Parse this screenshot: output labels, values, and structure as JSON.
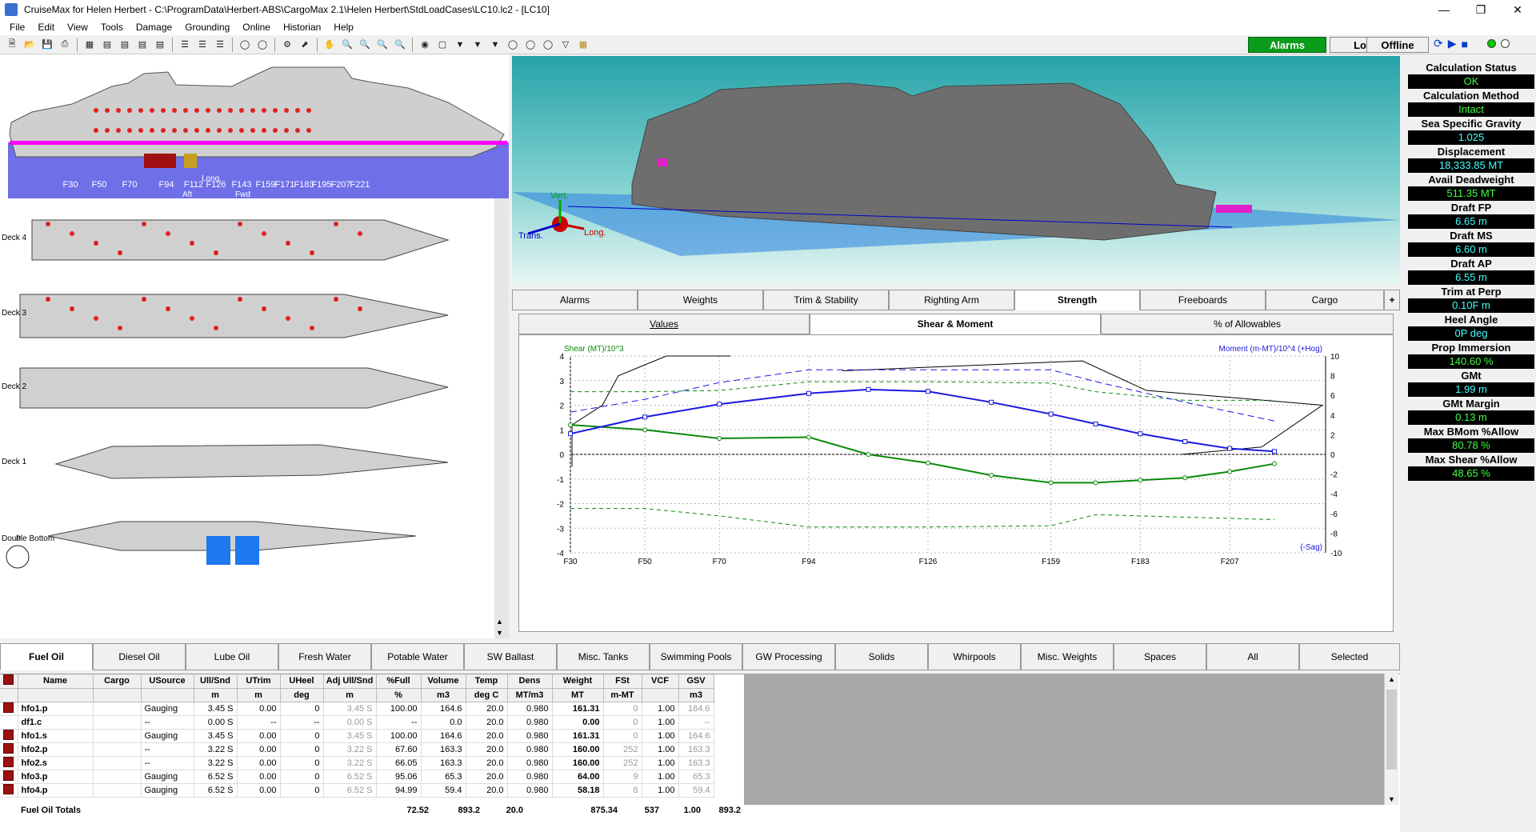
{
  "window": {
    "title": "CruiseMax for Helen Herbert - C:\\ProgramData\\Herbert-ABS\\CargoMax 2.1\\Helen Herbert\\StdLoadCases\\LC10.lc2 - [LC10]"
  },
  "menu": [
    "File",
    "Edit",
    "View",
    "Tools",
    "Damage",
    "Grounding",
    "Online",
    "Historian",
    "Help"
  ],
  "toolbar": {
    "alarms": "Alarms",
    "log": "Log",
    "offline": "Offline"
  },
  "profile": {
    "frames": [
      "F30",
      "F50",
      "F70",
      "F94",
      "F112",
      "F126",
      "F143",
      "F159",
      "F171",
      "F183",
      "F195",
      "F207",
      "F221"
    ],
    "aft": "Aft",
    "long": "Long.",
    "fwd": "Fwd"
  },
  "decks": [
    "Deck 4",
    "Deck 3",
    "Deck 2",
    "Deck 1",
    "Double Bottom"
  ],
  "compass": {
    "p": "P"
  },
  "view3d": {
    "vert": "Vert.",
    "trans": "Trans.",
    "long": "Long."
  },
  "main_tabs": [
    "Alarms",
    "Weights",
    "Trim & Stability",
    "Righting Arm",
    "Strength",
    "Freeboards",
    "Cargo"
  ],
  "main_tab_active": "Strength",
  "plus": "+",
  "sub_tabs": [
    "Values",
    "Shear & Moment",
    "% of Allowables"
  ],
  "chart_data": {
    "type": "line",
    "left_title": "Shear (MT)/10^3",
    "right_title": "Moment (m-MT)/10^4 (+Hog)",
    "sag_label": "(-Sag)",
    "x_ticks": [
      "F30",
      "F50",
      "F70",
      "F94",
      "F126",
      "F159",
      "F183",
      "F207"
    ],
    "ylim_left": [
      -4,
      4
    ],
    "ylim_right": [
      -10,
      10
    ],
    "y_ticks_left": [
      4,
      3,
      2,
      1,
      0,
      -1,
      -2,
      -3,
      -4
    ],
    "y_ticks_right": [
      10,
      8,
      6,
      4,
      2,
      0,
      -2,
      -4,
      -6,
      -8,
      -10
    ],
    "x": [
      30,
      50,
      70,
      94,
      110,
      126,
      143,
      159,
      171,
      183,
      195,
      207,
      219
    ],
    "shear": [
      1.2,
      1.0,
      0.65,
      0.7,
      0.0,
      -0.35,
      -0.85,
      -1.15,
      -1.15,
      -1.05,
      -0.95,
      -0.7,
      -0.38
    ],
    "moment": [
      2.1,
      3.8,
      5.1,
      6.2,
      6.6,
      6.4,
      5.3,
      4.1,
      3.1,
      2.1,
      1.3,
      0.6,
      0.3
    ],
    "shear_allow_pos": [
      [
        30,
        2.55
      ],
      [
        50,
        2.55
      ],
      [
        70,
        2.6
      ],
      [
        94,
        2.95
      ],
      [
        126,
        2.95
      ],
      [
        159,
        2.9
      ],
      [
        171,
        2.55
      ],
      [
        195,
        2.2
      ],
      [
        219,
        2.2
      ]
    ],
    "shear_allow_neg": [
      [
        30,
        -2.2
      ],
      [
        50,
        -2.2
      ],
      [
        70,
        -2.5
      ],
      [
        94,
        -2.95
      ],
      [
        126,
        -2.95
      ],
      [
        159,
        -2.9
      ],
      [
        171,
        -2.45
      ],
      [
        195,
        -2.55
      ],
      [
        219,
        -2.65
      ]
    ],
    "moment_allow": [
      [
        30,
        4.3
      ],
      [
        50,
        5.6
      ],
      [
        70,
        7.3
      ],
      [
        94,
        8.6
      ],
      [
        126,
        8.6
      ],
      [
        159,
        8.6
      ],
      [
        171,
        7.4
      ],
      [
        195,
        5.3
      ],
      [
        219,
        3.4
      ]
    ],
    "grid": true,
    "colors": {
      "shear": "#0a8a0a",
      "moment": "#1a1ae0"
    }
  },
  "status": [
    {
      "label": "Calculation Status",
      "value": "OK"
    },
    {
      "label": "Calculation Method",
      "value": "Intact"
    },
    {
      "label": "Sea Specific Gravity",
      "value": "1.025"
    },
    {
      "label": "Displacement",
      "value": "18,333.85 MT"
    },
    {
      "label": "Avail Deadweight",
      "value": "511.35 MT"
    },
    {
      "label": "Draft FP",
      "value": "6.65 m"
    },
    {
      "label": "Draft MS",
      "value": "6.60 m"
    },
    {
      "label": "Draft AP",
      "value": "6.55 m"
    },
    {
      "label": "Trim at Perp",
      "value": "0.10F m"
    },
    {
      "label": "Heel Angle",
      "value": "0P deg"
    },
    {
      "label": "Prop Immersion",
      "value": "140.60 %"
    },
    {
      "label": "GMt",
      "value": "1.99 m"
    },
    {
      "label": "GMt Margin",
      "value": "0.13 m"
    },
    {
      "label": "Max BMom %Allow",
      "value": "80.78 %"
    },
    {
      "label": "Max Shear %Allow",
      "value": "48.65 %"
    }
  ],
  "bottom_tabs": [
    "Fuel Oil",
    "Diesel Oil",
    "Lube Oil",
    "Fresh Water",
    "Potable Water",
    "SW Ballast",
    "Misc. Tanks",
    "Swimming Pools",
    "GW Processing",
    "Solids",
    "Whirpools",
    "Misc. Weights",
    "Spaces",
    "All",
    "Selected"
  ],
  "bottom_tab_active": "Fuel Oil",
  "table": {
    "headers": [
      "Name",
      "Cargo",
      "USource",
      "Ull/Snd",
      "UTrim",
      "UHeel",
      "Adj Ull/Snd",
      "%Full",
      "Volume",
      "Temp",
      "Dens",
      "Weight",
      "FSt",
      "VCF",
      "GSV"
    ],
    "units": [
      "",
      "",
      "",
      "m",
      "m",
      "deg",
      "m",
      "%",
      "m3",
      "deg C",
      "MT/m3",
      "MT",
      "m-MT",
      "",
      "m3"
    ],
    "rows": [
      [
        "hfo1.p",
        "",
        "Gauging",
        "3.45 S",
        "0.00",
        "0",
        "3.45 S",
        "100.00",
        "164.6",
        "20.0",
        "0.980",
        "161.31",
        "0",
        "1.00",
        "164.6"
      ],
      [
        "df1.c",
        "",
        "--",
        "0.00 S",
        "--",
        "--",
        "0.00 S",
        "--",
        "0.0",
        "20.0",
        "0.980",
        "0.00",
        "0",
        "1.00",
        "--"
      ],
      [
        "hfo1.s",
        "",
        "Gauging",
        "3.45 S",
        "0.00",
        "0",
        "3.45 S",
        "100.00",
        "164.6",
        "20.0",
        "0.980",
        "161.31",
        "0",
        "1.00",
        "164.6"
      ],
      [
        "hfo2.p",
        "",
        "--",
        "3.22 S",
        "0.00",
        "0",
        "3.22 S",
        "67.60",
        "163.3",
        "20.0",
        "0.980",
        "160.00",
        "252",
        "1.00",
        "163.3"
      ],
      [
        "hfo2.s",
        "",
        "--",
        "3.22 S",
        "0.00",
        "0",
        "3.22 S",
        "66.05",
        "163.3",
        "20.0",
        "0.980",
        "160.00",
        "252",
        "1.00",
        "163.3"
      ],
      [
        "hfo3.p",
        "",
        "Gauging",
        "6.52 S",
        "0.00",
        "0",
        "6.52 S",
        "95.06",
        "65.3",
        "20.0",
        "0.980",
        "64.00",
        "9",
        "1.00",
        "65.3"
      ],
      [
        "hfo4.p",
        "",
        "Gauging",
        "6.52 S",
        "0.00",
        "0",
        "6.52 S",
        "94.99",
        "59.4",
        "20.0",
        "0.980",
        "58.18",
        "8",
        "1.00",
        "59.4"
      ]
    ],
    "totals_label": "Fuel Oil Totals",
    "totals": {
      "pct": "72.52",
      "volume": "893.2",
      "temp": "20.0",
      "weight": "875.34",
      "fst": "537",
      "vcf": "1.00",
      "gsv": "893.2"
    }
  }
}
